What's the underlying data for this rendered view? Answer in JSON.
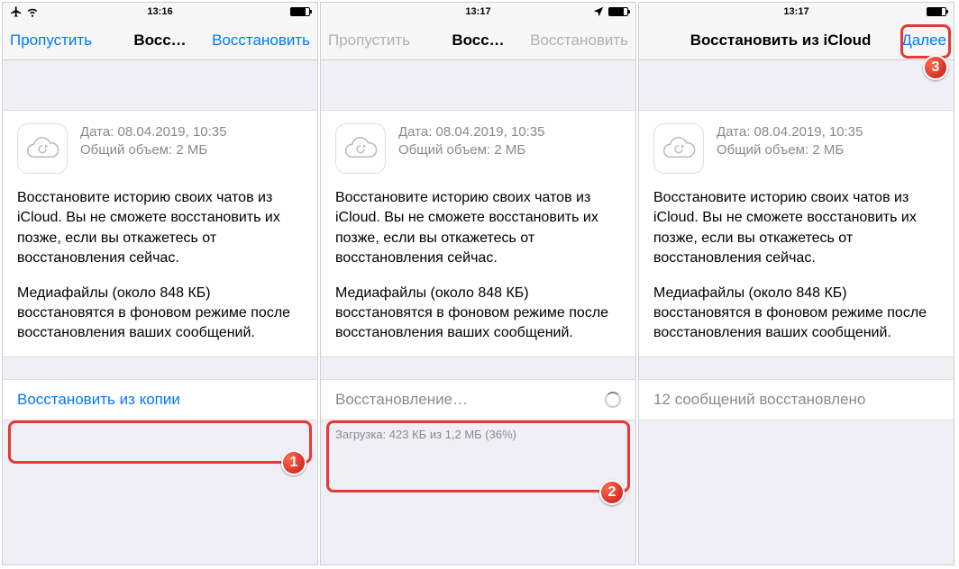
{
  "statusbar": {
    "time1": "13:16",
    "time2": "13:17",
    "time3": "13:17"
  },
  "phone1": {
    "nav_left": "Пропустить",
    "nav_title": "Восс…",
    "nav_right": "Восстановить",
    "info_date": "Дата: 08.04.2019, 10:35",
    "info_size": "Общий объем: 2 МБ",
    "desc1": "Восстановите историю своих чатов из iCloud. Вы не сможете восстановить их позже, если вы откажетесь от восстановления сейчас.",
    "desc2": "Медиафайлы (около 848 КБ) восстановятся в фоновом режиме после восстановления ваших сообщений.",
    "action": "Восстановить из копии"
  },
  "phone2": {
    "nav_left": "Пропустить",
    "nav_title": "Восс…",
    "nav_right": "Восстановить",
    "info_date": "Дата: 08.04.2019, 10:35",
    "info_size": "Общий объем: 2 МБ",
    "desc1": "Восстановите историю своих чатов из iCloud. Вы не сможете восстановить их позже, если вы откажетесь от восстановления сейчас.",
    "desc2": "Медиафайлы (около 848 КБ) восстановятся в фоновом режиме после восстановления ваших сообщений.",
    "action": "Восстановление…",
    "subtext": "Загрузка: 423 КБ из 1,2 МБ (36%)"
  },
  "phone3": {
    "nav_title": "Восстановить из iCloud",
    "nav_right": "Далее",
    "info_date": "Дата: 08.04.2019, 10:35",
    "info_size": "Общий объем: 2 МБ",
    "desc1": "Восстановите историю своих чатов из iCloud. Вы не сможете восстановить их позже, если вы откажетесь от восстановления сейчас.",
    "desc2": "Медиафайлы (около 848 КБ) восстановятся в фоновом режиме после восстановления ваших сообщений.",
    "action": "12 сообщений восстановлено"
  },
  "badges": {
    "b1": "1",
    "b2": "2",
    "b3": "3"
  }
}
